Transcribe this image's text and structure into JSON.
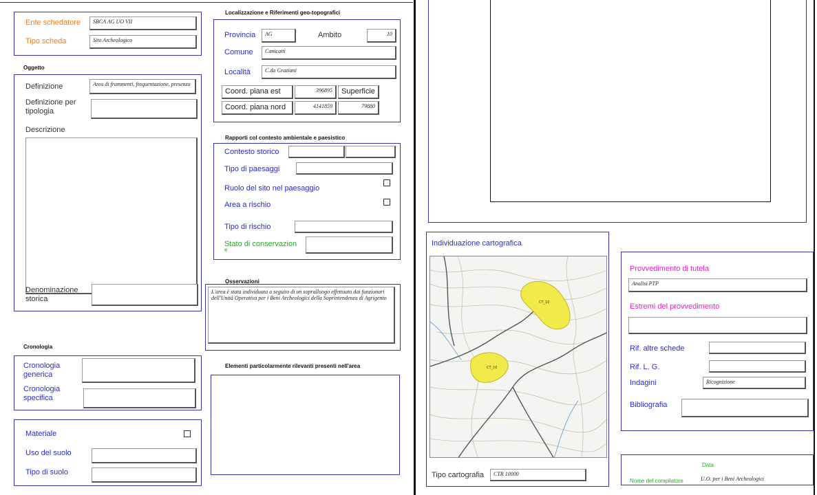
{
  "header": {
    "ente_label": "Ente schedatore",
    "ente_value": "SBCA AG UO VII",
    "tipo_scheda_label": "Tipo scheda",
    "tipo_scheda_value": "Sito Archeologico"
  },
  "oggetto": {
    "title": "Oggetto",
    "definizione_label": "Definizione",
    "definizione_value": "Area di frammenti, frequentazione, presenza",
    "def_tipologia_label_1": "Definizione per",
    "def_tipologia_label_2": "tipologia",
    "def_tipologia_value": "",
    "descrizione_label": "Descrizione",
    "descrizione_value": "",
    "denominazione_label_1": "Denominazione",
    "denominazione_label_2": "storica",
    "denominazione_value": ""
  },
  "cronologia": {
    "title": "Cronologia",
    "generica_label_1": "Cronologia",
    "generica_label_2": "generica",
    "generica_value": "",
    "specifica_label_1": "Cronologia",
    "specifica_label_2": "specifica",
    "specifica_value": ""
  },
  "materiale": {
    "materiale_label": "Materiale",
    "uso_suolo_label": "Uso del suolo",
    "uso_suolo_value": "",
    "tipo_suolo_label": "Tipo di suolo",
    "tipo_suolo_value": ""
  },
  "localizzazione": {
    "title": "Localizzazione e Riferimenti geo-topografici",
    "provincia_label": "Provincia",
    "provincia_value": "AG",
    "ambito_label": "Ambito",
    "ambito_value": "10",
    "comune_label": "Comune",
    "comune_value": "Canicattì",
    "localita_label": "Località",
    "localita_value": "C.da Graziani",
    "coord_est_label": "Coord. piana est",
    "coord_est_value": "396895",
    "superficie_label": "Superficie",
    "coord_nord_label": "Coord. piana nord",
    "coord_nord_value": "4141859",
    "superficie_value": "79880"
  },
  "rapporti": {
    "title": "Rapporti col contesto ambientale e paesistico",
    "contesto_label": "Contesto storico",
    "paesaggi_label": "Tipo di paesaggi",
    "ruolo_label": "Ruolo del sito nel paesaggio",
    "rischio_area_label": "Area a rischio",
    "tipo_rischio_label": "Tipo di rischio",
    "stato_label": "Stato di conservazion",
    "stato_label_2": "e"
  },
  "osservazioni": {
    "title": "Osservazioni",
    "text": "L'area è stata individuata a seguito di un sopralluogo effettuato dai funzionari dell'Unità Operativa per i Beni Archeologici della Soprintendenza di Agrigento"
  },
  "elementi": {
    "title": "Elementi particolarmente rilevanti presenti nell'area"
  },
  "cartografia": {
    "title": "Individuazione cartografica",
    "tipo_label": "Tipo cartografia",
    "tipo_value": "CTR 10000",
    "map_label_1": "CT_10",
    "map_label_2": "CT_10"
  },
  "tutela": {
    "provvedimento_label": "Provvedimento di tutela",
    "provvedimento_value": "Analisi PTP",
    "estremi_label": "Estremi del provvedimento",
    "estremi_value": "",
    "rif_schede_label": "Rif. altre schede",
    "rif_lg_label": "Rif. L. G.",
    "indagini_label": "Indagini",
    "indagini_value": "Ricognizione",
    "bibliografia_label": "Bibliografia"
  },
  "compilatore": {
    "data_label": "Data",
    "nome_label": "Nome del compilatore",
    "nome_value": "U.O. per i Beni Archeologici"
  },
  "colors": {
    "border": "#3333aa",
    "label_blue": "#2a2ad0",
    "label_orange": "#f07a1a",
    "label_magenta": "#e020c0",
    "label_green": "#22aa22",
    "map_site": "#f2ea4a"
  }
}
